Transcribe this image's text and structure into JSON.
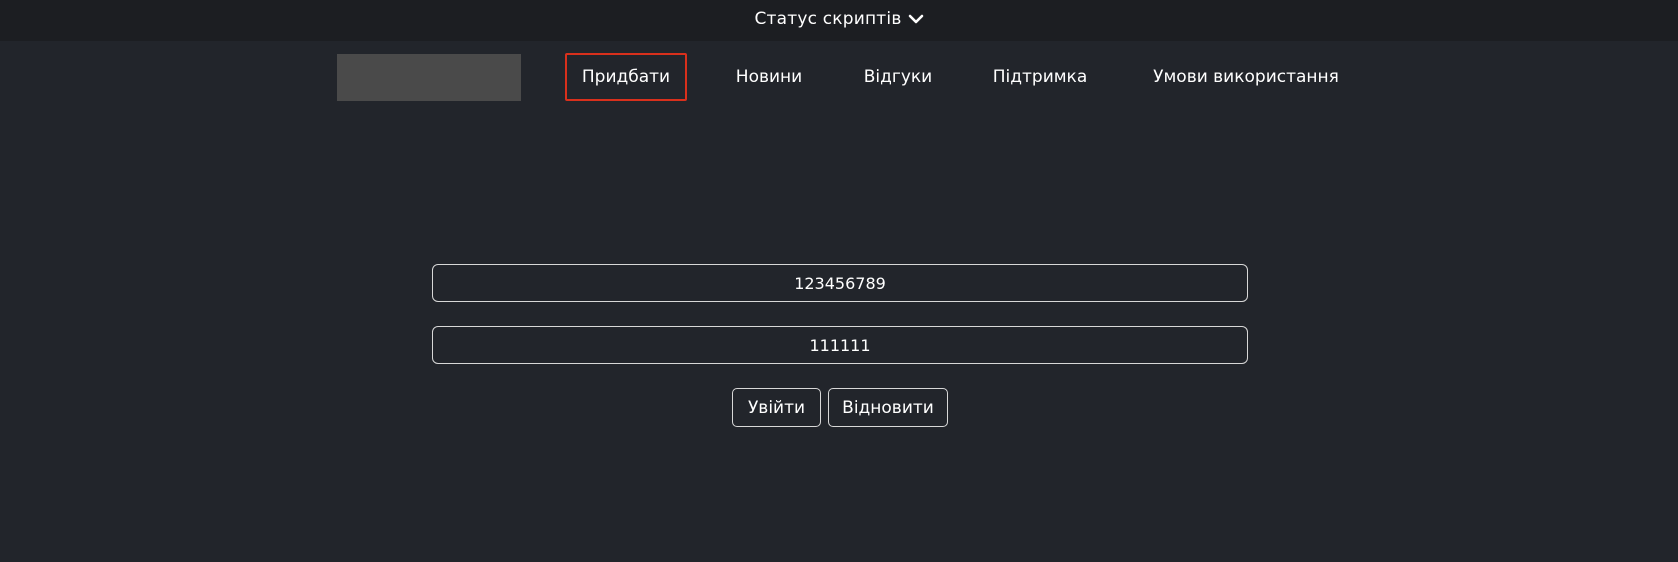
{
  "status_bar": {
    "label": "Статус скриптів",
    "icon": "chevron-down-icon"
  },
  "nav": {
    "items": [
      {
        "label": "Придбати",
        "active": true
      },
      {
        "label": "Новини",
        "active": false
      },
      {
        "label": "Відгуки",
        "active": false
      },
      {
        "label": "Підтримка",
        "active": false
      },
      {
        "label": "Умови використання",
        "active": false
      }
    ],
    "active_border_color": "#d9301c"
  },
  "login_form": {
    "login_value": "123456789",
    "password_value": "111111",
    "login_button": "Увійти",
    "restore_button": "Відновити"
  }
}
